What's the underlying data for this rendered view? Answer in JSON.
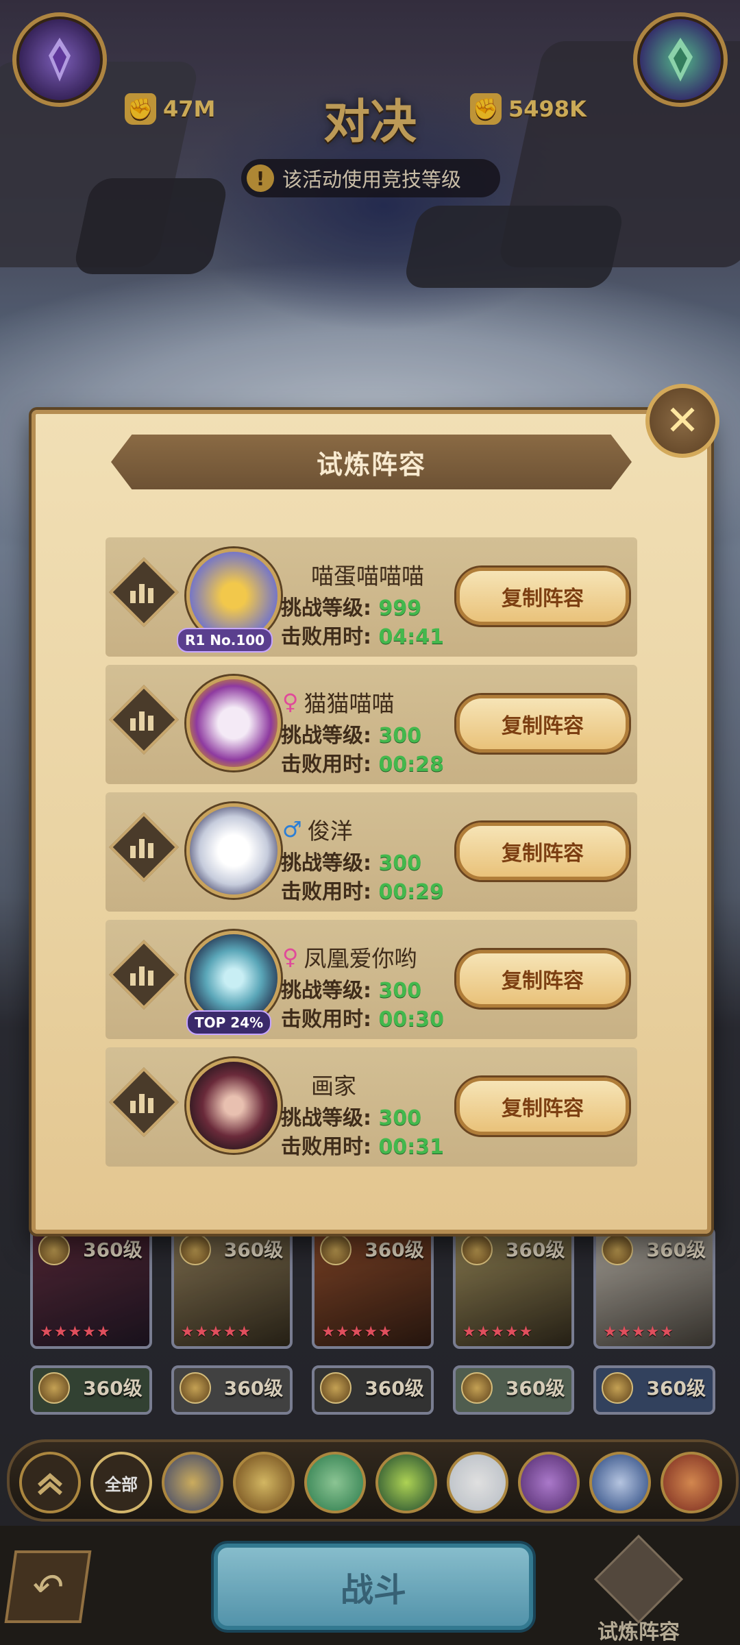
{
  "header": {
    "title": "对决",
    "left_power": "47M",
    "right_power": "5498K",
    "notice": "该活动使用竞技等级",
    "left_emblem_icon": "purple-faction-emblem-icon",
    "right_emblem_icon": "green-faction-emblem-icon"
  },
  "modal": {
    "title": "试炼阵容",
    "close_icon": "close-icon",
    "copy_label": "复制阵容",
    "level_label": "挑战等级:",
    "time_label": "击败用时:",
    "entries": [
      {
        "name": "喵蛋喵喵喵",
        "gender": "",
        "level": "999",
        "time": "04:41",
        "badge": "R1 No.100",
        "avatar_color": "#6b6fd1"
      },
      {
        "name": "猫猫喵喵",
        "gender": "♀",
        "level": "300",
        "time": "00:28",
        "badge": "",
        "avatar_color": "#d6c6e6"
      },
      {
        "name": "俊洋",
        "gender": "♂",
        "level": "300",
        "time": "00:29",
        "badge": "",
        "avatar_color": "#dfe4ee"
      },
      {
        "name": "凤凰爱你哟",
        "gender": "♀",
        "level": "300",
        "time": "00:30",
        "badge": "TOP 24%",
        "avatar_color": "#5aa6b8"
      },
      {
        "name": "画家",
        "gender": "",
        "level": "300",
        "time": "00:31",
        "badge": "",
        "avatar_color": "#6a2a3a"
      }
    ]
  },
  "heroes": {
    "level_label": "360级",
    "stars": "★★★★★"
  },
  "filter_bar": {
    "all_label": "全部",
    "colors": [
      "#c9a049",
      "#3e4a7c",
      "#7a4f1c",
      "#2f8a55",
      "#1f4f35",
      "#cfd6df",
      "#5b2f7a",
      "#2a4d8e",
      "#8a2f24"
    ]
  },
  "bottom": {
    "fight_label": "战斗",
    "trial_label": "试炼阵容",
    "back_icon": "back-arrow-icon"
  }
}
